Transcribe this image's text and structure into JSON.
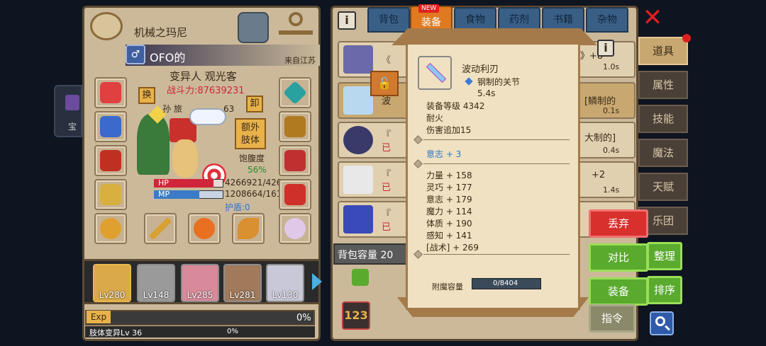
{
  "character": {
    "name": "机械之玛尼",
    "player": "OFO的",
    "origin": "来自江苏",
    "title": "变异人 观光客",
    "power": "战斗力:87639231",
    "swap_label": "换",
    "unload_label": "卸",
    "extra_body_label_1": "额外",
    "extra_body_label_2": "肢体",
    "satiety_label": "饱腹度",
    "satiety_value": "56%",
    "hp_label": "HP",
    "hp_value": "4266921/426",
    "hp_ratio": 0.86,
    "mp_label": "MP",
    "mp_value": "1208664/161",
    "mp_ratio": 0.65,
    "shield": "护盾:0",
    "status_partial": "孙 旅",
    "status_num": "63"
  },
  "party": [
    {
      "level": "Lv280",
      "color": "#d9a94a"
    },
    {
      "level": "Lv148",
      "color": "#9a9a9a"
    },
    {
      "level": "Lv285",
      "color": "#d88a9a"
    },
    {
      "level": "Lv281",
      "color": "#a07a5a"
    },
    {
      "level": "Lv130",
      "color": "#c8c8d8"
    }
  ],
  "exp": {
    "label": "Exp",
    "value": "0%",
    "class_label": "肢体变异Lv 36",
    "class_value": "0%"
  },
  "tabs": [
    {
      "label": "背包"
    },
    {
      "label": "装备",
      "badge": "NEW"
    },
    {
      "label": "食物"
    },
    {
      "label": "药剂"
    },
    {
      "label": "书籍"
    },
    {
      "label": "杂物"
    }
  ],
  "bag_rows": [
    {
      "name": "《",
      "right": "》+8",
      "sub": "1.0s"
    },
    {
      "name": "波",
      "right": "[鳞制的",
      "sub": "0.1s"
    },
    {
      "name": "『",
      "tag": "已",
      "right": "大制的]",
      "sub": "0.4s"
    },
    {
      "name": "『",
      "tag": "已",
      "right": "+2",
      "sub": "1.4s"
    },
    {
      "name": "『",
      "tag": "已",
      "right": "",
      "sub": ""
    }
  ],
  "bag_capacity": "背包容量 20",
  "side_menu": [
    {
      "label": "道具"
    },
    {
      "label": "属性"
    },
    {
      "label": "技能"
    },
    {
      "label": "魔法"
    },
    {
      "label": "天赋"
    },
    {
      "label": "乐团"
    }
  ],
  "buttons": {
    "discard": "丢弃",
    "compare": "对比",
    "equip": "装备",
    "tidy": "整理",
    "sort": "排序",
    "command": "指令"
  },
  "tooltip": {
    "item_name": "波动利刃",
    "material": "钢制的关节",
    "speed": "5.4s",
    "equip_level": "装备等级 4342",
    "property1": "耐火",
    "property2": "伤害追加15",
    "bonus": "意志 + 3",
    "stats": [
      "力量 + 158",
      "灵巧 + 177",
      "意志 + 179",
      "魔力 + 114",
      "体质 + 190",
      "感知 + 141",
      "[战术] + 269"
    ],
    "enchant_label": "附魔容量",
    "enchant_value": "0/8404"
  },
  "colors": {
    "hp": "#d0253a",
    "mp": "#3b7bc8",
    "accent_blue": "#2e78c8",
    "discard_red": "#d8302c",
    "panel": "#cbb99a"
  }
}
